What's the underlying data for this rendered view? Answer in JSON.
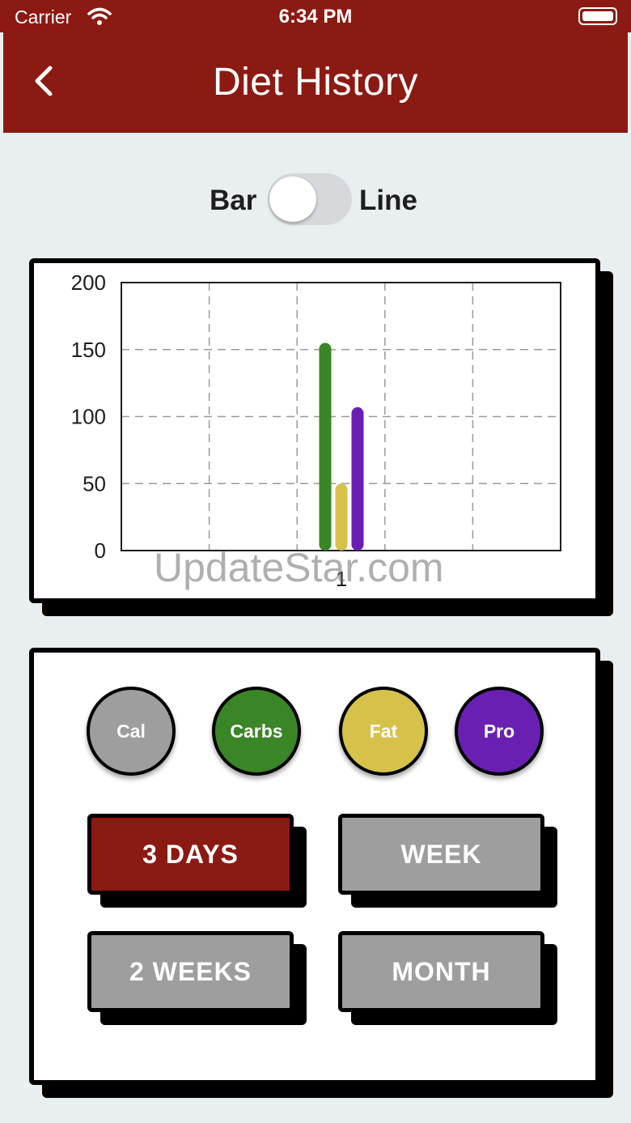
{
  "status_bar": {
    "carrier": "Carrier",
    "time": "6:34 PM"
  },
  "nav": {
    "title": "Diet History",
    "back_icon": "chevron-left-icon"
  },
  "toggle": {
    "left_label": "Bar",
    "right_label": "Line",
    "state": "Bar"
  },
  "chart_data": {
    "type": "bar",
    "categories": [
      "1"
    ],
    "series": [
      {
        "color": "#3a8526",
        "values": [
          155
        ]
      },
      {
        "color": "#d6c24b",
        "values": [
          50
        ]
      },
      {
        "color": "#6a1fb3",
        "values": [
          107
        ]
      }
    ],
    "ylim": [
      0,
      200
    ],
    "yticks": [
      "0",
      "50",
      "100",
      "150",
      "200"
    ],
    "grid": true
  },
  "nutrients": [
    {
      "label": "Cal",
      "color": "#9e9e9e"
    },
    {
      "label": "Carbs",
      "color": "#3a8526"
    },
    {
      "label": "Fat",
      "color": "#d6c24b"
    },
    {
      "label": "Pro",
      "color": "#6a1fb3"
    }
  ],
  "ranges": [
    {
      "label": "3 DAYS",
      "selected": true
    },
    {
      "label": "WEEK",
      "selected": false
    },
    {
      "label": "2 WEEKS",
      "selected": false
    },
    {
      "label": "MONTH",
      "selected": false
    }
  ],
  "colors": {
    "accent": "#8b1a12",
    "inactive_button": "#9e9e9e",
    "background": "#e9eef1"
  },
  "watermark": "UpdateStar.com"
}
